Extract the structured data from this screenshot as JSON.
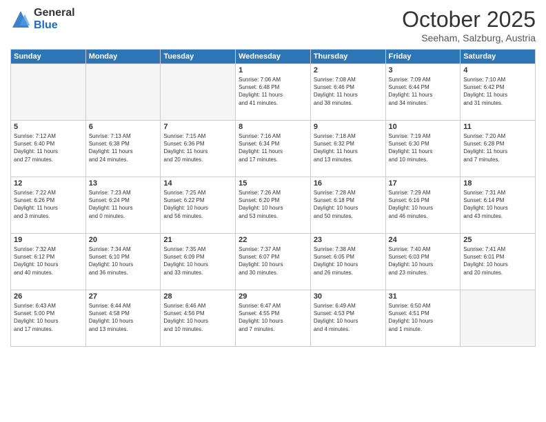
{
  "header": {
    "logo_general": "General",
    "logo_blue": "Blue",
    "month_title": "October 2025",
    "location": "Seeham, Salzburg, Austria"
  },
  "weekdays": [
    "Sunday",
    "Monday",
    "Tuesday",
    "Wednesday",
    "Thursday",
    "Friday",
    "Saturday"
  ],
  "weeks": [
    [
      {
        "day": "",
        "info": ""
      },
      {
        "day": "",
        "info": ""
      },
      {
        "day": "",
        "info": ""
      },
      {
        "day": "1",
        "info": "Sunrise: 7:06 AM\nSunset: 6:48 PM\nDaylight: 11 hours\nand 41 minutes."
      },
      {
        "day": "2",
        "info": "Sunrise: 7:08 AM\nSunset: 6:46 PM\nDaylight: 11 hours\nand 38 minutes."
      },
      {
        "day": "3",
        "info": "Sunrise: 7:09 AM\nSunset: 6:44 PM\nDaylight: 11 hours\nand 34 minutes."
      },
      {
        "day": "4",
        "info": "Sunrise: 7:10 AM\nSunset: 6:42 PM\nDaylight: 11 hours\nand 31 minutes."
      }
    ],
    [
      {
        "day": "5",
        "info": "Sunrise: 7:12 AM\nSunset: 6:40 PM\nDaylight: 11 hours\nand 27 minutes."
      },
      {
        "day": "6",
        "info": "Sunrise: 7:13 AM\nSunset: 6:38 PM\nDaylight: 11 hours\nand 24 minutes."
      },
      {
        "day": "7",
        "info": "Sunrise: 7:15 AM\nSunset: 6:36 PM\nDaylight: 11 hours\nand 20 minutes."
      },
      {
        "day": "8",
        "info": "Sunrise: 7:16 AM\nSunset: 6:34 PM\nDaylight: 11 hours\nand 17 minutes."
      },
      {
        "day": "9",
        "info": "Sunrise: 7:18 AM\nSunset: 6:32 PM\nDaylight: 11 hours\nand 13 minutes."
      },
      {
        "day": "10",
        "info": "Sunrise: 7:19 AM\nSunset: 6:30 PM\nDaylight: 11 hours\nand 10 minutes."
      },
      {
        "day": "11",
        "info": "Sunrise: 7:20 AM\nSunset: 6:28 PM\nDaylight: 11 hours\nand 7 minutes."
      }
    ],
    [
      {
        "day": "12",
        "info": "Sunrise: 7:22 AM\nSunset: 6:26 PM\nDaylight: 11 hours\nand 3 minutes."
      },
      {
        "day": "13",
        "info": "Sunrise: 7:23 AM\nSunset: 6:24 PM\nDaylight: 11 hours\nand 0 minutes."
      },
      {
        "day": "14",
        "info": "Sunrise: 7:25 AM\nSunset: 6:22 PM\nDaylight: 10 hours\nand 56 minutes."
      },
      {
        "day": "15",
        "info": "Sunrise: 7:26 AM\nSunset: 6:20 PM\nDaylight: 10 hours\nand 53 minutes."
      },
      {
        "day": "16",
        "info": "Sunrise: 7:28 AM\nSunset: 6:18 PM\nDaylight: 10 hours\nand 50 minutes."
      },
      {
        "day": "17",
        "info": "Sunrise: 7:29 AM\nSunset: 6:16 PM\nDaylight: 10 hours\nand 46 minutes."
      },
      {
        "day": "18",
        "info": "Sunrise: 7:31 AM\nSunset: 6:14 PM\nDaylight: 10 hours\nand 43 minutes."
      }
    ],
    [
      {
        "day": "19",
        "info": "Sunrise: 7:32 AM\nSunset: 6:12 PM\nDaylight: 10 hours\nand 40 minutes."
      },
      {
        "day": "20",
        "info": "Sunrise: 7:34 AM\nSunset: 6:10 PM\nDaylight: 10 hours\nand 36 minutes."
      },
      {
        "day": "21",
        "info": "Sunrise: 7:35 AM\nSunset: 6:09 PM\nDaylight: 10 hours\nand 33 minutes."
      },
      {
        "day": "22",
        "info": "Sunrise: 7:37 AM\nSunset: 6:07 PM\nDaylight: 10 hours\nand 30 minutes."
      },
      {
        "day": "23",
        "info": "Sunrise: 7:38 AM\nSunset: 6:05 PM\nDaylight: 10 hours\nand 26 minutes."
      },
      {
        "day": "24",
        "info": "Sunrise: 7:40 AM\nSunset: 6:03 PM\nDaylight: 10 hours\nand 23 minutes."
      },
      {
        "day": "25",
        "info": "Sunrise: 7:41 AM\nSunset: 6:01 PM\nDaylight: 10 hours\nand 20 minutes."
      }
    ],
    [
      {
        "day": "26",
        "info": "Sunrise: 6:43 AM\nSunset: 5:00 PM\nDaylight: 10 hours\nand 17 minutes."
      },
      {
        "day": "27",
        "info": "Sunrise: 6:44 AM\nSunset: 4:58 PM\nDaylight: 10 hours\nand 13 minutes."
      },
      {
        "day": "28",
        "info": "Sunrise: 6:46 AM\nSunset: 4:56 PM\nDaylight: 10 hours\nand 10 minutes."
      },
      {
        "day": "29",
        "info": "Sunrise: 6:47 AM\nSunset: 4:55 PM\nDaylight: 10 hours\nand 7 minutes."
      },
      {
        "day": "30",
        "info": "Sunrise: 6:49 AM\nSunset: 4:53 PM\nDaylight: 10 hours\nand 4 minutes."
      },
      {
        "day": "31",
        "info": "Sunrise: 6:50 AM\nSunset: 4:51 PM\nDaylight: 10 hours\nand 1 minute."
      },
      {
        "day": "",
        "info": ""
      }
    ]
  ]
}
